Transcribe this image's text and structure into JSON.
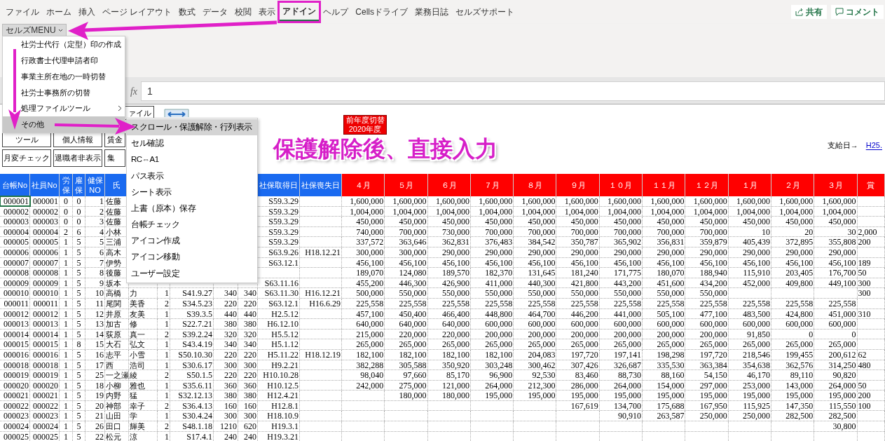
{
  "menu_tabs": [
    {
      "label": "ファイル",
      "selected": false
    },
    {
      "label": "ホーム",
      "selected": false
    },
    {
      "label": "挿入",
      "selected": false
    },
    {
      "label": "ページ レイアウト",
      "selected": false
    },
    {
      "label": "数式",
      "selected": false
    },
    {
      "label": "データ",
      "selected": false
    },
    {
      "label": "校閲",
      "selected": false
    },
    {
      "label": "表示",
      "selected": false
    },
    {
      "label": "アドイン",
      "selected": true
    },
    {
      "label": "ヘルプ",
      "selected": false
    },
    {
      "label": "Cellsドライブ",
      "selected": false
    },
    {
      "label": "業務日誌",
      "selected": false
    },
    {
      "label": "セルズサポート",
      "selected": false
    }
  ],
  "share_button": "共有",
  "comment_button": "コメント",
  "ribbon_button": "セルズMENU",
  "formula_bar": {
    "fx": "fx",
    "value": "1"
  },
  "sheet_buttons": [
    [
      "ァイル"
    ],
    [
      "ツール",
      "個人情報",
      "賃金"
    ],
    [
      "月変チェック",
      "退職者非表示",
      "集"
    ]
  ],
  "year_switch": [
    "前年度切替",
    "2020年度"
  ],
  "annotation_text": "保護解除後、直接入力",
  "pay_date": {
    "label": "支給日→",
    "value": "H25."
  },
  "table": {
    "columns": [
      {
        "label": "台帳No",
        "color": "#1a6af0"
      },
      {
        "label": "社員No",
        "color": "#1a6af0"
      },
      {
        "label": "労保",
        "color": "#1a6af0"
      },
      {
        "label": "雇保",
        "color": "#1a6af0"
      },
      {
        "label": "健保NO",
        "color": "#1a6af0"
      },
      {
        "label": "氏",
        "color": "#1a6af0"
      },
      {},
      {},
      {},
      {},
      {},
      {
        "label": "社保取得日",
        "color": "#1a6af0"
      },
      {
        "label": "社保喪失日",
        "color": "#1a6af0"
      },
      {
        "label": "４月",
        "color": "#ff0000"
      },
      {
        "label": "５月",
        "color": "#ff0000"
      },
      {
        "label": "６月",
        "color": "#ff0000"
      },
      {
        "label": "７月",
        "color": "#ff0000"
      },
      {
        "label": "８月",
        "color": "#ff0000"
      },
      {
        "label": "９月",
        "color": "#ff0000"
      },
      {
        "label": "１０月",
        "color": "#ff0000"
      },
      {
        "label": "１１月",
        "color": "#ff0000"
      },
      {
        "label": "１２月",
        "color": "#ff0000"
      },
      {
        "label": "１月",
        "color": "#ff0000"
      },
      {
        "label": "２月",
        "color": "#ff0000"
      },
      {
        "label": "３月",
        "color": "#ff0000"
      },
      {
        "label": "賞",
        "color": "#ff0000"
      }
    ],
    "rows": [
      {
        "selected": true,
        "cells": [
          "000001",
          "000001",
          "0",
          "0",
          "1",
          "佐藤",
          null,
          null,
          null,
          null,
          null,
          "S59.3.29",
          null,
          "1,600,000",
          "1,600,000",
          "1,600,000",
          "1,600,000",
          "1,600,000",
          "1,600,000",
          "1,600,000",
          "1,600,000",
          "1,600,000",
          "1,600,000",
          "1,600,000",
          "1,600,000",
          null
        ]
      },
      {
        "selected": false,
        "cells": [
          "000002",
          "000002",
          "0",
          "0",
          "2",
          "佐藤",
          null,
          null,
          null,
          null,
          null,
          "S59.3.29",
          null,
          "1,004,000",
          "1,004,000",
          "1,004,000",
          "1,004,000",
          "1,004,000",
          "1,004,000",
          "1,004,000",
          "1,004,000",
          "1,004,000",
          "1,004,000",
          "1,004,000",
          "1,004,000",
          null
        ]
      },
      {
        "selected": false,
        "cells": [
          "000003",
          "000003",
          "0",
          "0",
          "3",
          "佐藤",
          null,
          null,
          null,
          null,
          null,
          "S59.3.29",
          null,
          "450,000",
          "450,000",
          "450,000",
          "450,000",
          "450,000",
          "450,000",
          "450,000",
          "450,000",
          "450,000",
          "450,000",
          "450,000",
          "450,000",
          null
        ]
      },
      {
        "selected": false,
        "cells": [
          "000004",
          "000004",
          "2",
          "6",
          "4",
          "小林",
          null,
          null,
          null,
          null,
          null,
          "S59.3.29",
          null,
          "740,000",
          "700,000",
          "730,000",
          "700,000",
          "700,000",
          "700,000",
          "700,000",
          "700,000",
          "700,000",
          "10",
          "20",
          "30",
          "2,000"
        ]
      },
      {
        "selected": false,
        "cells": [
          "000005",
          "000005",
          "1",
          "5",
          "5",
          "三浦",
          null,
          null,
          null,
          null,
          null,
          "S59.3.29",
          null,
          "337,572",
          "363,646",
          "362,831",
          "376,483",
          "384,542",
          "350,787",
          "365,902",
          "356,831",
          "359,879",
          "405,439",
          "372,895",
          "355,808",
          "200"
        ]
      },
      {
        "selected": false,
        "cells": [
          "000006",
          "000006",
          "1",
          "5",
          "6",
          "高木",
          null,
          null,
          null,
          null,
          null,
          "S63.9.26",
          "H18.12.21",
          "300,000",
          "300,000",
          "290,000",
          "290,000",
          "290,000",
          "290,000",
          "290,000",
          "290,000",
          "290,000",
          "290,000",
          "290,000",
          "290,000",
          null
        ]
      },
      {
        "selected": false,
        "cells": [
          "000007",
          "000007",
          "1",
          "5",
          "7",
          "伊勢",
          null,
          null,
          null,
          null,
          null,
          "S63.12.1",
          null,
          "456,100",
          "456,100",
          "456,100",
          "456,100",
          "456,100",
          "456,100",
          "456,100",
          "456,100",
          "456,100",
          "456,100",
          "456,100",
          "456,100",
          "189"
        ]
      },
      {
        "selected": false,
        "cells": [
          "000008",
          "000008",
          "1",
          "5",
          "8",
          "後藤",
          null,
          null,
          null,
          null,
          null,
          null,
          null,
          "189,070",
          "124,080",
          "189,570",
          "182,370",
          "131,645",
          "181,240",
          "171,775",
          "180,070",
          "188,940",
          "115,910",
          "203,405",
          "176,700",
          "50"
        ]
      },
      {
        "selected": false,
        "cells": [
          "000009",
          "000009",
          "1",
          "5",
          "9",
          "坂本",
          null,
          null,
          null,
          null,
          null,
          "S63.11.16",
          null,
          "455,200",
          "446,300",
          "426,900",
          "411,000",
          "440,300",
          "421,800",
          "443,200",
          "451,600",
          "434,200",
          "452,000",
          "409,800",
          "449,100",
          "300"
        ]
      },
      {
        "selected": false,
        "cells": [
          "000010",
          "000010",
          "1",
          "5",
          "10",
          "高橋",
          "力",
          "1",
          "S41.9.27",
          "340",
          "340",
          "S63.11.30",
          "H16.12.21",
          "500,000",
          "550,000",
          "550,000",
          "550,000",
          "550,000",
          "550,000",
          "550,000",
          "550,000",
          "550,000",
          null,
          null,
          null,
          "300"
        ]
      },
      {
        "selected": false,
        "cells": [
          "000011",
          "000011",
          "1",
          "5",
          "11",
          "尾関",
          "美香",
          "2",
          "S34.5.23",
          "220",
          "220",
          "S63.12.1",
          "H16.6.29",
          "225,558",
          "225,558",
          "225,558",
          "225,558",
          "225,558",
          "225,558",
          "225,558",
          "225,558",
          "225,558",
          "225,558",
          "225,558",
          "225,558",
          null
        ]
      },
      {
        "selected": false,
        "cells": [
          "000012",
          "000012",
          "1",
          "5",
          "12",
          "井原",
          "友美",
          "1",
          "S39.3.5",
          "440",
          "440",
          "H2.5.12",
          null,
          "457,100",
          "450,400",
          "466,400",
          "448,800",
          "464,700",
          "446,200",
          "441,000",
          "505,100",
          "477,100",
          "483,500",
          "424,800",
          "451,000",
          "310"
        ]
      },
      {
        "selected": false,
        "cells": [
          "000013",
          "000013",
          "1",
          "5",
          "13",
          "加古",
          "修",
          "1",
          "S22.7.21",
          "380",
          "380",
          "H6.12.10",
          null,
          "640,000",
          "640,000",
          "640,000",
          "600,000",
          "600,000",
          "600,000",
          "600,000",
          "600,000",
          "600,000",
          "600,000",
          "600,000",
          "600,000",
          null
        ]
      },
      {
        "selected": false,
        "cells": [
          "000014",
          "000014",
          "1",
          "5",
          "14",
          "荻原",
          "真一",
          "2",
          "S39.2.24",
          "320",
          "320",
          "H5.5.12",
          null,
          "215,000",
          "220,000",
          "220,000",
          "200,000",
          "200,000",
          "200,000",
          "200,000",
          "200,000",
          "200,000",
          "91,850",
          "0",
          "0",
          null
        ]
      },
      {
        "selected": false,
        "cells": [
          "000015",
          "000015",
          "1",
          "8",
          "15",
          "大石",
          "弘文",
          "1",
          "S43.4.19",
          "340",
          "340",
          "H5.1.12",
          null,
          "265,000",
          "265,000",
          "265,000",
          "265,000",
          "265,000",
          "265,000",
          "265,000",
          "265,000",
          "265,000",
          "265,000",
          "265,000",
          "265,000",
          null
        ]
      },
      {
        "selected": false,
        "cells": [
          "000016",
          "000016",
          "1",
          "5",
          "16",
          "志平",
          "小雪",
          "1",
          "S50.10.30",
          "220",
          "220",
          "H5.11.22",
          "H18.12.19",
          "182,100",
          "182,100",
          "182,100",
          "182,100",
          "204,083",
          "197,720",
          "197,141",
          "198,298",
          "197,720",
          "218,546",
          "199,455",
          "200,612",
          "62"
        ]
      },
      {
        "selected": false,
        "cells": [
          "000018",
          "000018",
          "1",
          "5",
          "17",
          "西",
          "浩司",
          "1",
          "S30.6.17",
          "300",
          "300",
          "H9.2.21",
          null,
          "382,288",
          "305,588",
          "350,920",
          "303,248",
          "300,462",
          "307,426",
          "326,687",
          "335,530",
          "363,384",
          "354,638",
          "362,576",
          "314,250",
          "480"
        ]
      },
      {
        "selected": false,
        "cells": [
          "000019",
          "000019",
          "1",
          "5",
          "25",
          "一之瀬",
          "綾",
          "2",
          "S50.1.5",
          "220",
          "220",
          "H10.10.28",
          null,
          "98,040",
          "97,660",
          "85,170",
          "96,900",
          "92,530",
          "83,460",
          "88,730",
          "88,160",
          "54,150",
          "46,170",
          "89,110",
          "90,820",
          null
        ]
      },
      {
        "selected": false,
        "cells": [
          "000020",
          "000020",
          "1",
          "5",
          "18",
          "小柳",
          "雅也",
          "1",
          "S35.6.11",
          "360",
          "360",
          "H10.12.5",
          null,
          "242,000",
          "275,000",
          "121,000",
          "264,000",
          "212,300",
          "286,000",
          "264,000",
          "154,000",
          "297,000",
          "253,000",
          "143,000",
          "264,000",
          "50"
        ]
      },
      {
        "selected": false,
        "cells": [
          "000021",
          "000021",
          "1",
          "5",
          "19",
          "内野",
          "猛",
          "1",
          "S32.12.13",
          "380",
          "380",
          "H12.4.21",
          null,
          null,
          "180,000",
          "180,000",
          "195,000",
          "195,000",
          "195,000",
          "195,000",
          "195,000",
          "195,000",
          "195,000",
          "195,000",
          "195,000",
          "200"
        ]
      },
      {
        "selected": false,
        "cells": [
          "000022",
          "000022",
          "1",
          "5",
          "20",
          "神部",
          "幸子",
          "2",
          "S36.4.13",
          "160",
          "160",
          "H12.8.1",
          null,
          null,
          null,
          null,
          null,
          null,
          "167,619",
          "134,700",
          "175,688",
          "167,950",
          "115,925",
          "147,350",
          "115,550",
          "100"
        ]
      },
      {
        "selected": false,
        "cells": [
          "000023",
          "000023",
          "1",
          "5",
          "21",
          "山田",
          "学",
          "1",
          "S30.4.24",
          "300",
          "300",
          "H18.10.9",
          null,
          null,
          null,
          null,
          null,
          null,
          null,
          "90,910",
          "263,587",
          "250,000",
          "250,000",
          "282,500",
          "282,500",
          null
        ]
      },
      {
        "selected": false,
        "cells": [
          "000024",
          "000024",
          "1",
          "5",
          "26",
          "田口",
          "輝美",
          "2",
          "S48.1.18",
          "1210",
          "620",
          "H19.3.1",
          null,
          null,
          null,
          null,
          null,
          null,
          null,
          null,
          null,
          null,
          null,
          null,
          "30,800",
          null
        ]
      },
      {
        "selected": false,
        "cells": [
          "000025",
          "000025",
          "1",
          "5",
          "22",
          "松元",
          "涼",
          "1",
          "S17.4.1",
          "240",
          "240",
          "H19.3.21",
          null,
          null,
          null,
          null,
          null,
          null,
          null,
          null,
          null,
          null,
          null,
          null,
          null,
          null
        ]
      }
    ]
  },
  "main_menu": [
    {
      "label": "社労士代行（定型）印の作成",
      "submenu": false,
      "selected": false
    },
    {
      "label": "行政書士代理申請者印",
      "submenu": false,
      "selected": false
    },
    {
      "label": "事業主所在地の一時切替",
      "submenu": false,
      "selected": false
    },
    {
      "label": "社労士事務所の切替",
      "submenu": false,
      "selected": false
    },
    {
      "label": "処理ファイルツール",
      "submenu": true,
      "selected": false
    },
    {
      "label": "その他",
      "submenu": false,
      "selected": true
    }
  ],
  "submenu": [
    {
      "label": "スクロール・保護解除・行列表示",
      "selected": true
    },
    {
      "label": "セル確認",
      "selected": false
    },
    {
      "label": "RC⇔A1",
      "selected": false
    },
    {
      "label": "パス表示",
      "selected": false
    },
    {
      "label": "シート表示",
      "selected": false
    },
    {
      "label": "上書（原本）保存",
      "selected": false
    },
    {
      "label": "台帳チェック",
      "selected": false
    },
    {
      "label": "アイコン作成",
      "selected": false
    },
    {
      "label": "アイコン移動",
      "selected": false
    },
    {
      "label": "ユーザー設定",
      "selected": false
    }
  ]
}
